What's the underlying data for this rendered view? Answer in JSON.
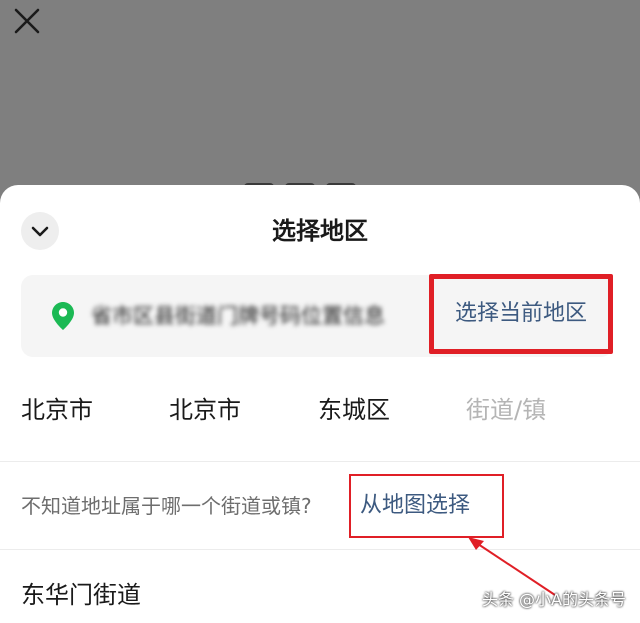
{
  "header": {
    "close_icon": "close-icon"
  },
  "sheet": {
    "title": "选择地区",
    "collapse_icon": "chevron-down-icon",
    "location_card": {
      "pin_icon": "location-pin-icon",
      "pin_color": "#1bb954",
      "address": "省市区县街道门牌号码位置信息",
      "current_region_button": "选择当前地区"
    },
    "level_tabs": [
      {
        "label": "北京市"
      },
      {
        "label": "北京市"
      },
      {
        "label": "东城区"
      },
      {
        "label": "街道/镇"
      }
    ],
    "hint": {
      "text": "不知道地址属于哪一个街道或镇?",
      "map_link": "从地图选择"
    },
    "streets": [
      {
        "label": "东华门街道"
      }
    ]
  },
  "annotation_color": "#e01f26",
  "link_color": "#3d5a80",
  "watermark": "头条 @小A的头条号"
}
